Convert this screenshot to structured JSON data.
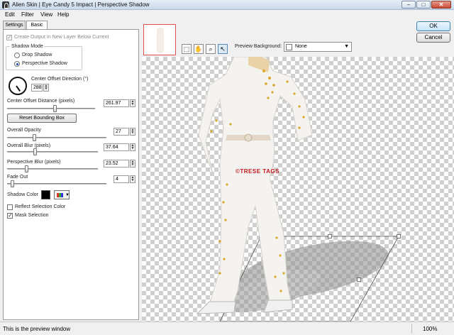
{
  "window": {
    "title": "Alien Skin | Eye Candy 5 Impact | Perspective Shadow",
    "minimize": "–",
    "maximize": "□",
    "close": "✕"
  },
  "menu": [
    "Edit",
    "Filter",
    "View",
    "Help"
  ],
  "tabs": [
    "Settings",
    "Basic"
  ],
  "basic": {
    "create_output": "Create Output In New Layer Below Current",
    "shadow_mode_title": "Shadow Mode",
    "drop_shadow": "Drop Shadow",
    "perspective_shadow": "Perspective Shadow",
    "center_offset_direction_label": "Center Offset Direction (°)",
    "center_offset_direction": "288",
    "center_offset_distance_label": "Center Offset Distance (pixels)",
    "center_offset_distance": "261.97",
    "reset_bounding_box": "Reset Bounding Box",
    "overall_opacity_label": "Overall Opacity",
    "overall_opacity": "27",
    "overall_blur_label": "Overall Blur (pixels)",
    "overall_blur": "37.64",
    "perspective_blur_label": "Perspective Blur (pixels)",
    "perspective_blur": "23.52",
    "fade_out_label": "Fade Out",
    "fade_out": "4",
    "shadow_color_label": "Shadow Color",
    "shadow_color": "#000000",
    "reflect_selection_color": "Reflect Selection Color",
    "mask_selection": "Mask Selection"
  },
  "sliders": {
    "center_offset_distance": 0.55,
    "overall_opacity": 0.27,
    "overall_blur": 0.3,
    "perspective_blur": 0.2,
    "fade_out": 0.04
  },
  "buttons": {
    "ok": "OK",
    "cancel": "Cancel"
  },
  "preview_toolbar": {
    "background_label": "Preview Background:",
    "background_value": "None",
    "tools": [
      "selection-tool-icon",
      "hand-tool-icon",
      "zoom-tool-icon",
      "arrow-tool-icon"
    ]
  },
  "preview": {
    "watermark": "©TRESE TAGS"
  },
  "status": {
    "message": "This is the preview window",
    "zoom": "100%"
  },
  "colors": {
    "accent": "#3c7fb1",
    "watermark": "#c0141b",
    "shadow": "#000000"
  }
}
